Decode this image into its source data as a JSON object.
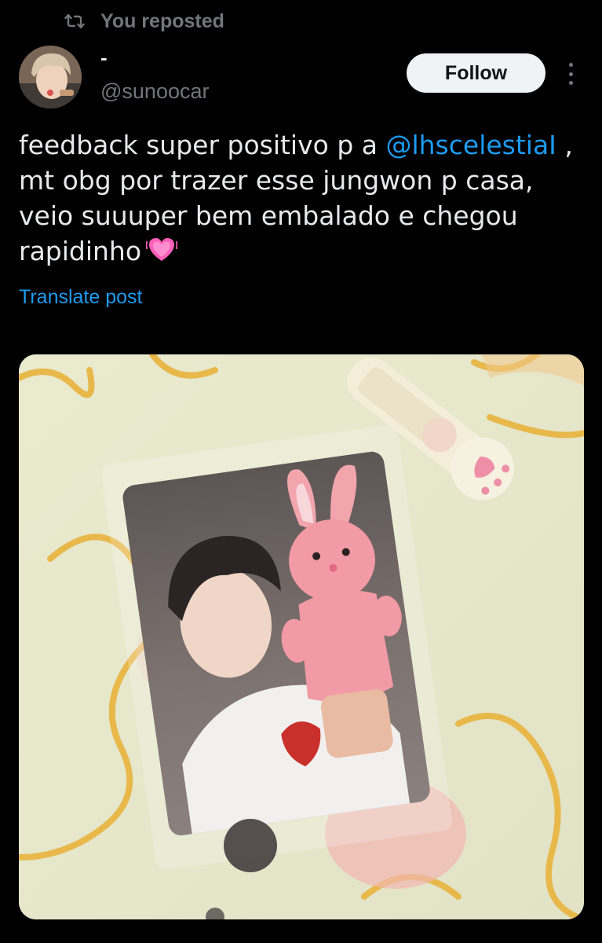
{
  "repost": {
    "icon": "repost-icon",
    "label": "You reposted"
  },
  "author": {
    "display_name": "-",
    "handle": "@sunoocar",
    "avatar_icon": "avatar"
  },
  "follow_label": "Follow",
  "more_icon": "more-options-icon",
  "post": {
    "text_before": "feedback super positivo p a ",
    "mention": "@lhscelestiaI",
    "text_after": " , mt obg por trazer esse jungwon p casa, veio suuuper bem embalado e chegou rapidinho",
    "emoji": "growing-heart-emoji"
  },
  "translate_label": "Translate post",
  "colors": {
    "background": "#000000",
    "text": "#e7e9ea",
    "muted": "#71767b",
    "accent": "#1d9bf0",
    "follow_bg": "#eff3f4"
  }
}
